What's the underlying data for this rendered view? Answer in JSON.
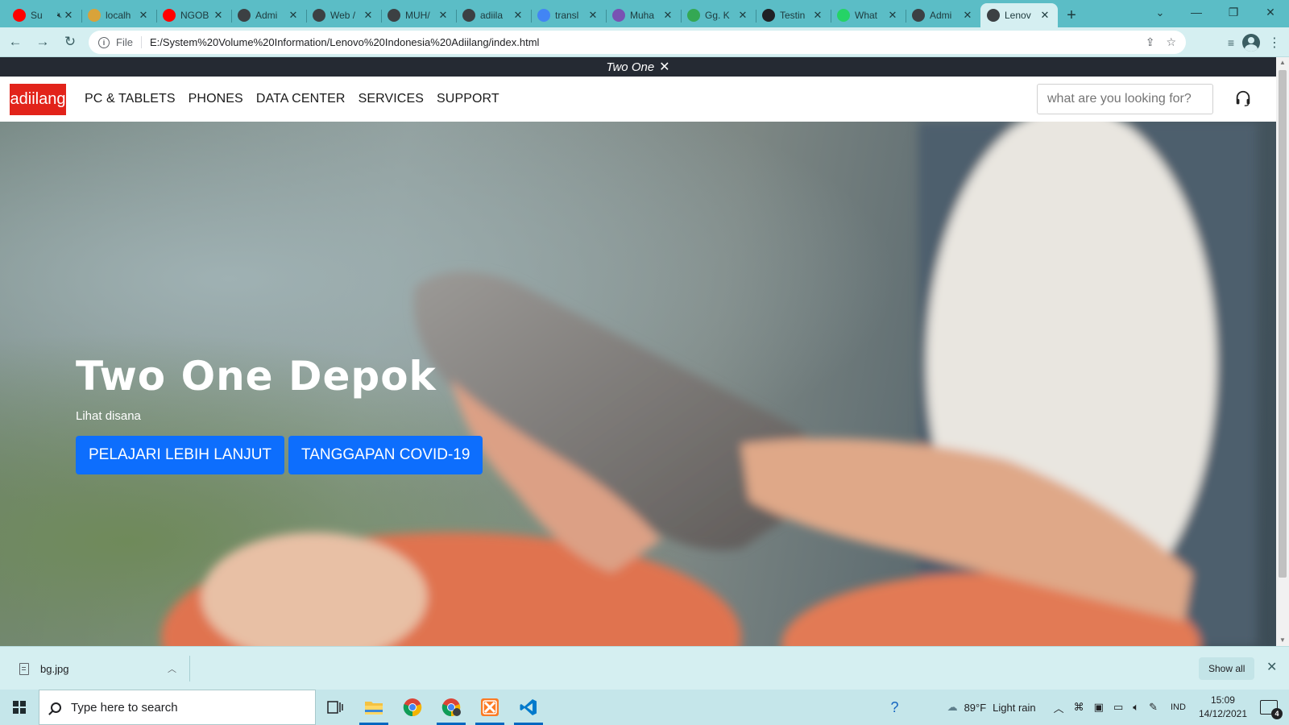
{
  "browser": {
    "tabs": [
      {
        "title": "Su",
        "favicon": "youtube-icon",
        "color": "#ff0000",
        "muted": true
      },
      {
        "title": "localh",
        "favicon": "xampp-folder-icon",
        "color": "#d8a33a"
      },
      {
        "title": "NGOB",
        "favicon": "youtube-icon",
        "color": "#ff0000"
      },
      {
        "title": "Admi",
        "favicon": "globe-icon",
        "color": "#3c4043"
      },
      {
        "title": "Web /",
        "favicon": "globe-icon",
        "color": "#3c4043"
      },
      {
        "title": "MUH/",
        "favicon": "globe-icon",
        "color": "#3c4043"
      },
      {
        "title": "adiila",
        "favicon": "globe-icon",
        "color": "#3c4043"
      },
      {
        "title": "transl",
        "favicon": "google-icon",
        "color": "#4285f4"
      },
      {
        "title": "Muha",
        "favicon": "bootstrap-icon",
        "color": "#7952b3"
      },
      {
        "title": "Gg. K",
        "favicon": "maps-icon",
        "color": "#34a853"
      },
      {
        "title": "Testin",
        "favicon": "g-icon",
        "color": "#202124"
      },
      {
        "title": "What",
        "favicon": "whatsapp-icon",
        "color": "#25d366"
      },
      {
        "title": "Admi",
        "favicon": "globe-icon",
        "color": "#3c4043"
      },
      {
        "title": "Lenov",
        "favicon": "globe-icon",
        "color": "#3c4043",
        "active": true
      }
    ],
    "address": {
      "scheme": "File",
      "url": "E:/System%20Volume%20Information/Lenovo%20Indonesia%20Adiilang/index.html"
    }
  },
  "page": {
    "promo": {
      "text": "Two One",
      "close": "✕"
    },
    "logo": "adiilang",
    "brand_color": "#e2231a",
    "menu": [
      "PC & TABLETS",
      "PHONES",
      "DATA CENTER",
      "SERVICES",
      "SUPPORT"
    ],
    "search_placeholder": "what are you looking for?",
    "hero": {
      "title": "Two One Depok",
      "subtitle": "Lihat disana",
      "buttons": [
        "PELAJARI LEBIH LANJUT",
        "TANGGAPAN COVID-19"
      ],
      "button_color": "#0d6efd"
    }
  },
  "downloads": {
    "file": "bg.jpg",
    "show_all": "Show all"
  },
  "taskbar": {
    "search_placeholder": "Type here to search",
    "apps": [
      "task-view-icon",
      "file-explorer-icon",
      "chrome-icon",
      "chrome-profile-icon",
      "xampp-icon",
      "vscode-icon"
    ],
    "weather": {
      "temp": "89°F",
      "condition": "Light rain"
    },
    "language": "IND",
    "time": "15:09",
    "date": "14/12/2021",
    "notifications": "4"
  }
}
